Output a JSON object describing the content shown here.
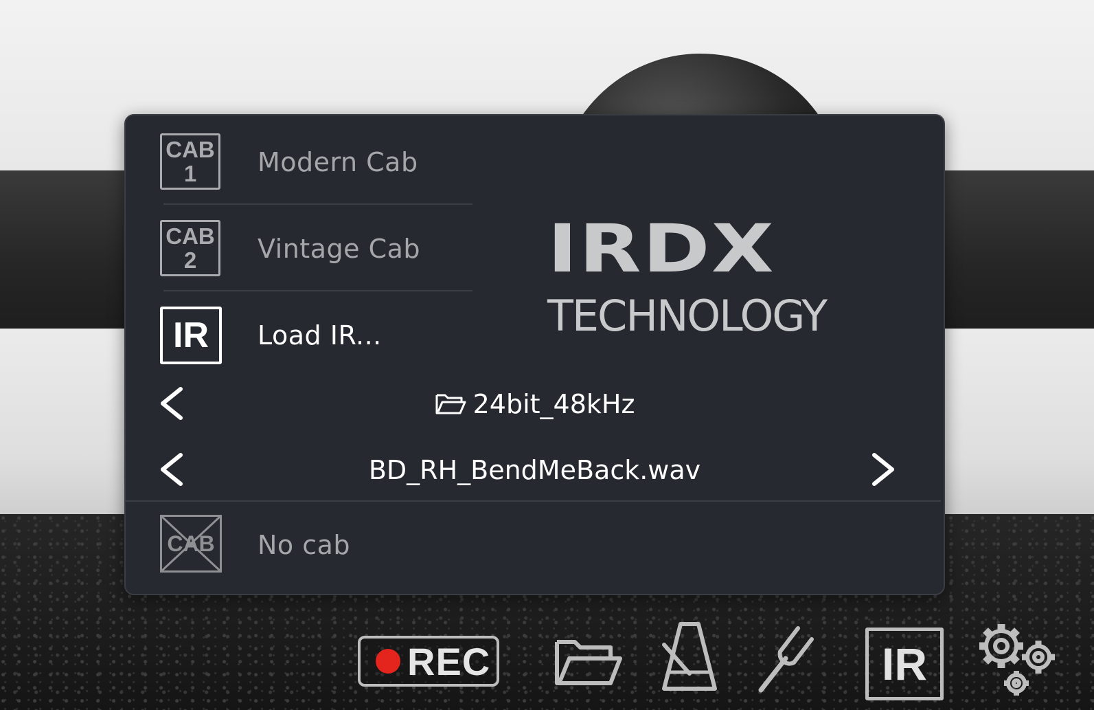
{
  "panel": {
    "cabs": [
      {
        "line1": "CAB",
        "line2": "1",
        "label": "Modern Cab"
      },
      {
        "line1": "CAB",
        "line2": "2",
        "label": "Vintage Cab"
      }
    ],
    "ir_icon": "IR",
    "load_label": "Load IR...",
    "logo_main": "IRDX",
    "logo_sub": "TECHNOLOGY",
    "folder_name": "24bit_48kHz",
    "file_name": "BD_RH_BendMeBack.wav",
    "nocab_icon": "CAB",
    "nocab_label": "No cab"
  },
  "toolbar": {
    "rec_label": "REC",
    "ir_label": "IR",
    "icons": [
      "record-icon",
      "folder-icon",
      "metronome-icon",
      "tuner-fork-icon",
      "ir-icon",
      "settings-gears-icon"
    ]
  },
  "colors": {
    "panel_bg": "#262930",
    "rec_dot": "#e3251d",
    "text_dim": "#a4a6aa",
    "text_bright": "#ffffff"
  }
}
